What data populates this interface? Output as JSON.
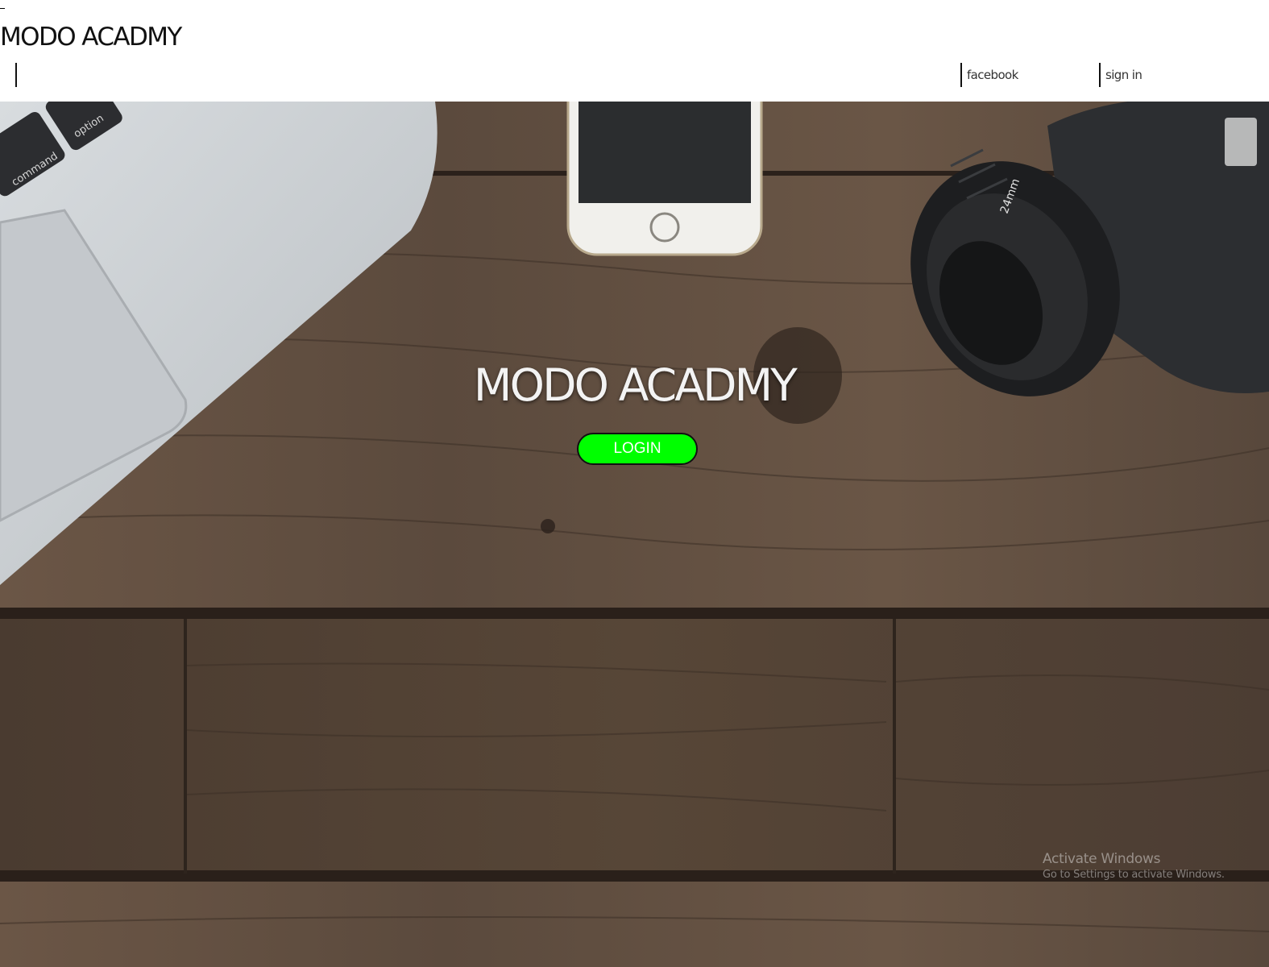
{
  "header": {
    "site_title": "MODO ACADMY",
    "nav": {
      "facebook_label": "facebook",
      "signin_label": "sign in"
    }
  },
  "hero": {
    "title": "MODO ACADMY",
    "login_label": "LOGIN",
    "background_description_icons": [
      "laptop-image",
      "phone-image",
      "camera-image",
      "wood-desk-image"
    ],
    "keyboard_keys": [
      "command",
      "option"
    ]
  },
  "watermark": {
    "line1": "Activate Windows",
    "line2": "Go to Settings to activate Windows."
  },
  "colors": {
    "login_button": "#00ff00",
    "hero_text": "#f3f3f3",
    "wood": "#5f4e40"
  }
}
